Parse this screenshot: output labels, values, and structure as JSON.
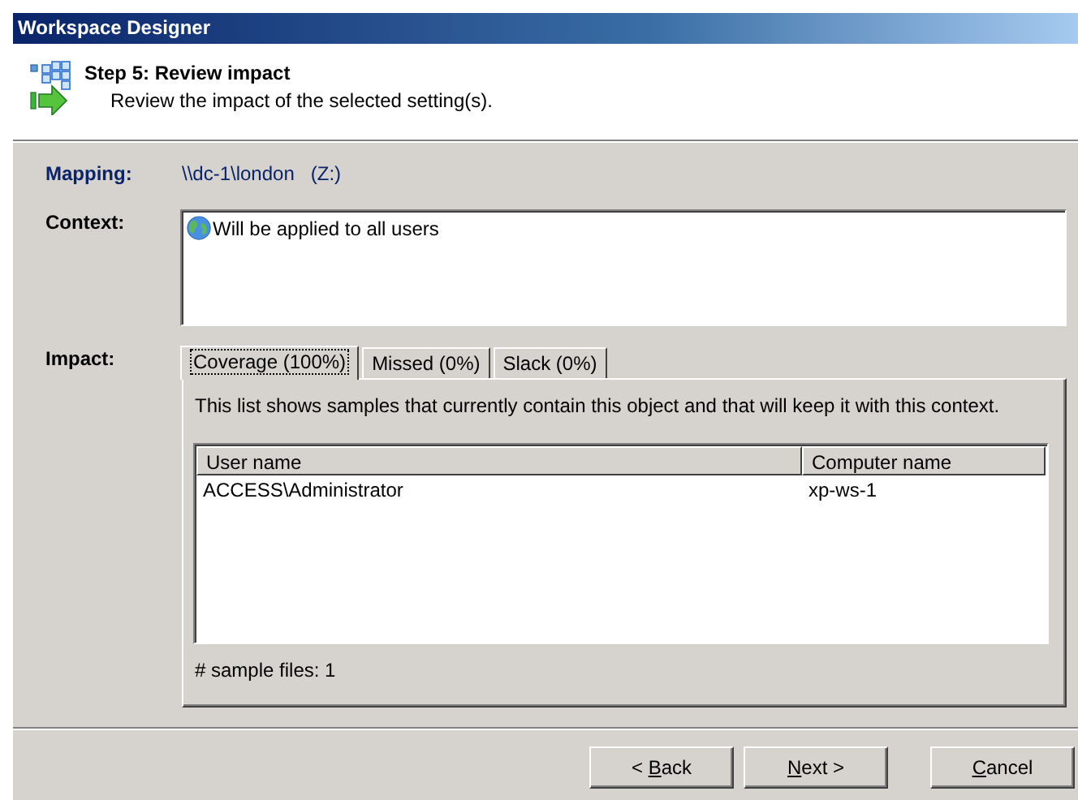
{
  "window": {
    "title": "Workspace Designer"
  },
  "header": {
    "step": "Step 5: Review impact",
    "description": "Review the impact of the selected setting(s)."
  },
  "mapping": {
    "label": "Mapping:",
    "value": "\\\\dc-1\\london   (Z:)"
  },
  "context": {
    "label": "Context:",
    "items": [
      "Will be applied to all users"
    ]
  },
  "impact": {
    "label": "Impact:",
    "tabs": [
      {
        "label": "Coverage (100%)",
        "selected": true
      },
      {
        "label": "Missed (0%)",
        "selected": false
      },
      {
        "label": "Slack (0%)",
        "selected": false
      }
    ],
    "description": "This list shows samples that currently contain this object and that will keep it with this context.",
    "table": {
      "columns": [
        "User name",
        "Computer name"
      ],
      "rows": [
        [
          "ACCESS\\Administrator",
          "xp-ws-1"
        ]
      ]
    },
    "footer": "# sample files: 1"
  },
  "buttons": [
    {
      "before": "< ",
      "mnemonic": "B",
      "after": "ack"
    },
    {
      "mnemonic": "N",
      "after": "ext >"
    },
    {
      "mnemonic": "C",
      "after": "ancel"
    }
  ]
}
